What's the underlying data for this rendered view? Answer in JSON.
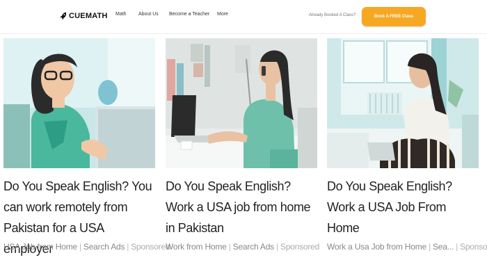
{
  "header": {
    "logo_text": "CUEMATH",
    "nav": {
      "math": "Math",
      "about": "About Us",
      "teacher": "Become a Teacher",
      "more": "More"
    },
    "booked_text": "Already Booked A Class?",
    "cta_label": "Book A FREE Class",
    "accent_color": "#f7a823"
  },
  "ads": [
    {
      "title": "Do You Speak English? You can work remotely from Pakistan for a USA employer",
      "source": "USA Job from Home",
      "separator": "|",
      "network": "Search Ads",
      "sponsored": "Sponsored"
    },
    {
      "title": "Do You Speak English? Work a USA job from home in Pakistan",
      "source": "Work from Home",
      "separator": "|",
      "network": "Search Ads",
      "sponsored": "Sponsored"
    },
    {
      "title": "Do You Speak English? Work a USA Job From Home",
      "source": "Work a Usa Job from Home",
      "separator": "|",
      "network": "Sea...",
      "sponsored": "Sponsored"
    }
  ]
}
